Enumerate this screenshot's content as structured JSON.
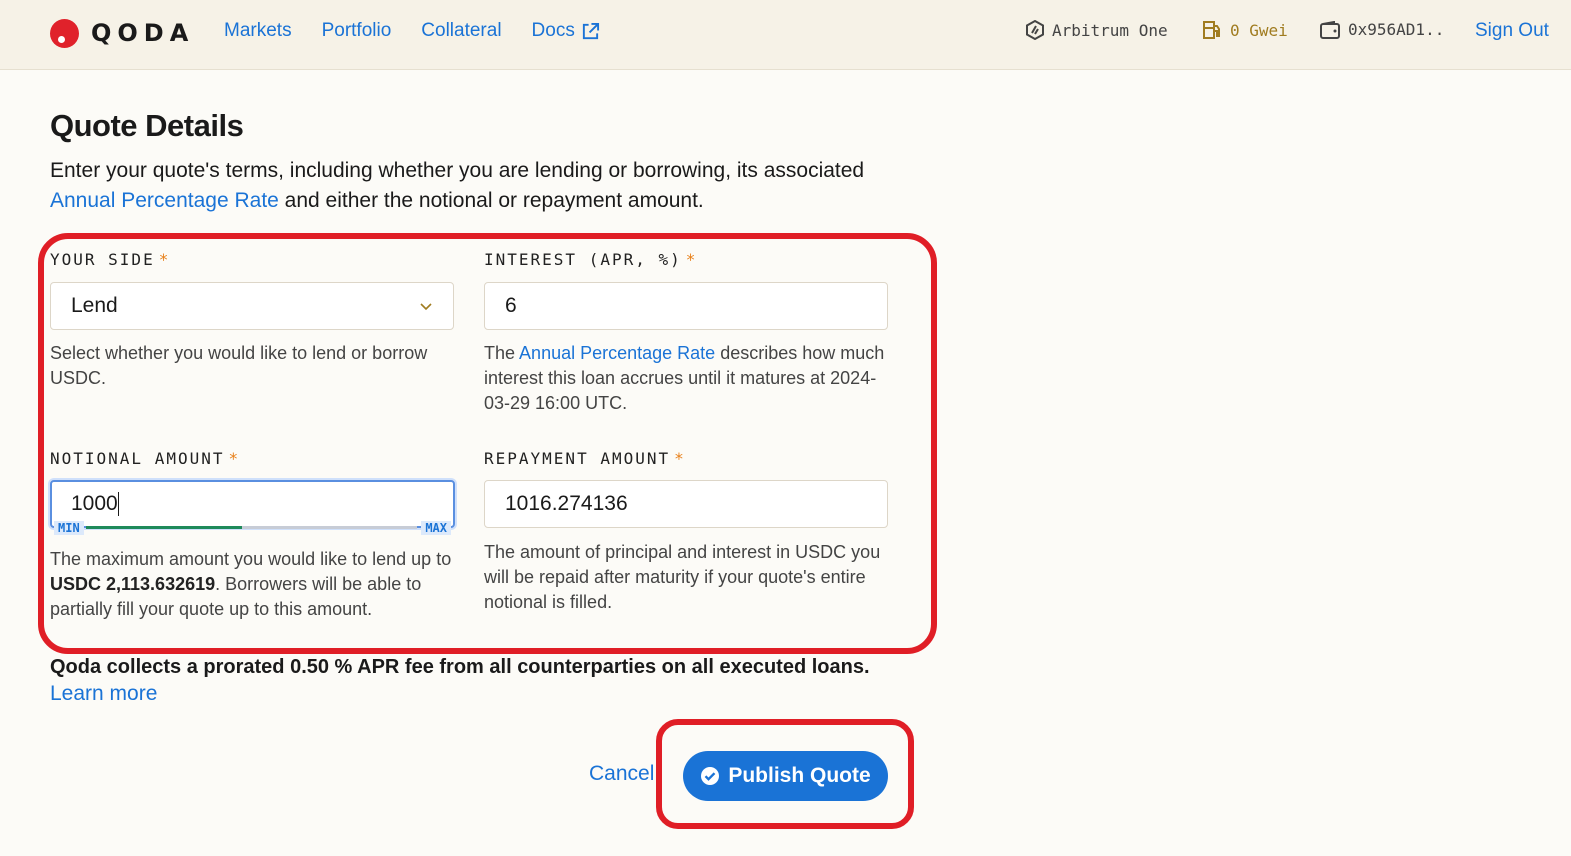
{
  "header": {
    "logo_text": "QODA",
    "nav": [
      {
        "label": "Markets"
      },
      {
        "label": "Portfolio"
      },
      {
        "label": "Collateral"
      },
      {
        "label": "Docs"
      }
    ],
    "network": "Arbitrum One",
    "gas": "0 Gwei",
    "wallet": "0x956AD1..",
    "sign_out": "Sign Out"
  },
  "page": {
    "title": "Quote Details",
    "intro_text": "Enter your quote's terms, including whether you are lending or borrowing, its associated",
    "intro_link": "Annual Percentage Rate",
    "intro_tail": "and either the notional or repayment amount."
  },
  "form": {
    "side": {
      "label": "YOUR SIDE",
      "required": "*",
      "value": "Lend",
      "help": "Select whether you would like to lend or borrow USDC."
    },
    "interest": {
      "label": "INTEREST (APR, %)",
      "required": "*",
      "value": "6",
      "help_pre": "The",
      "help_link": "Annual Percentage Rate",
      "help_post": "describes how much interest this loan accrues until it matures at 2024-03-29 16:00 UTC."
    },
    "notional": {
      "label": "NOTIONAL AMOUNT",
      "required": "*",
      "value": "1000",
      "slider_min": "MIN",
      "slider_max": "MAX",
      "help_pre": "The maximum amount you would like to lend up to",
      "help_bold": "USDC 2,113.632619",
      "help_post": ". Borrowers will be able to partially fill your quote up to this amount."
    },
    "repayment": {
      "label": "REPAYMENT AMOUNT",
      "required": "*",
      "value": "1016.274136",
      "help": "The amount of principal and interest in USDC you will be repaid after maturity if your quote's entire notional is filled."
    }
  },
  "fee_text": "Qoda collects a prorated 0.50 % APR fee from all counterparties on all executed loans.",
  "learn_more": "Learn more",
  "actions": {
    "cancel": "Cancel",
    "publish": "Publish Quote"
  },
  "colors": {
    "accent": "#1a73d6",
    "brand_red": "#e0222b",
    "highlight": "#e01e26",
    "slider_fill": "#1f8a5b"
  }
}
